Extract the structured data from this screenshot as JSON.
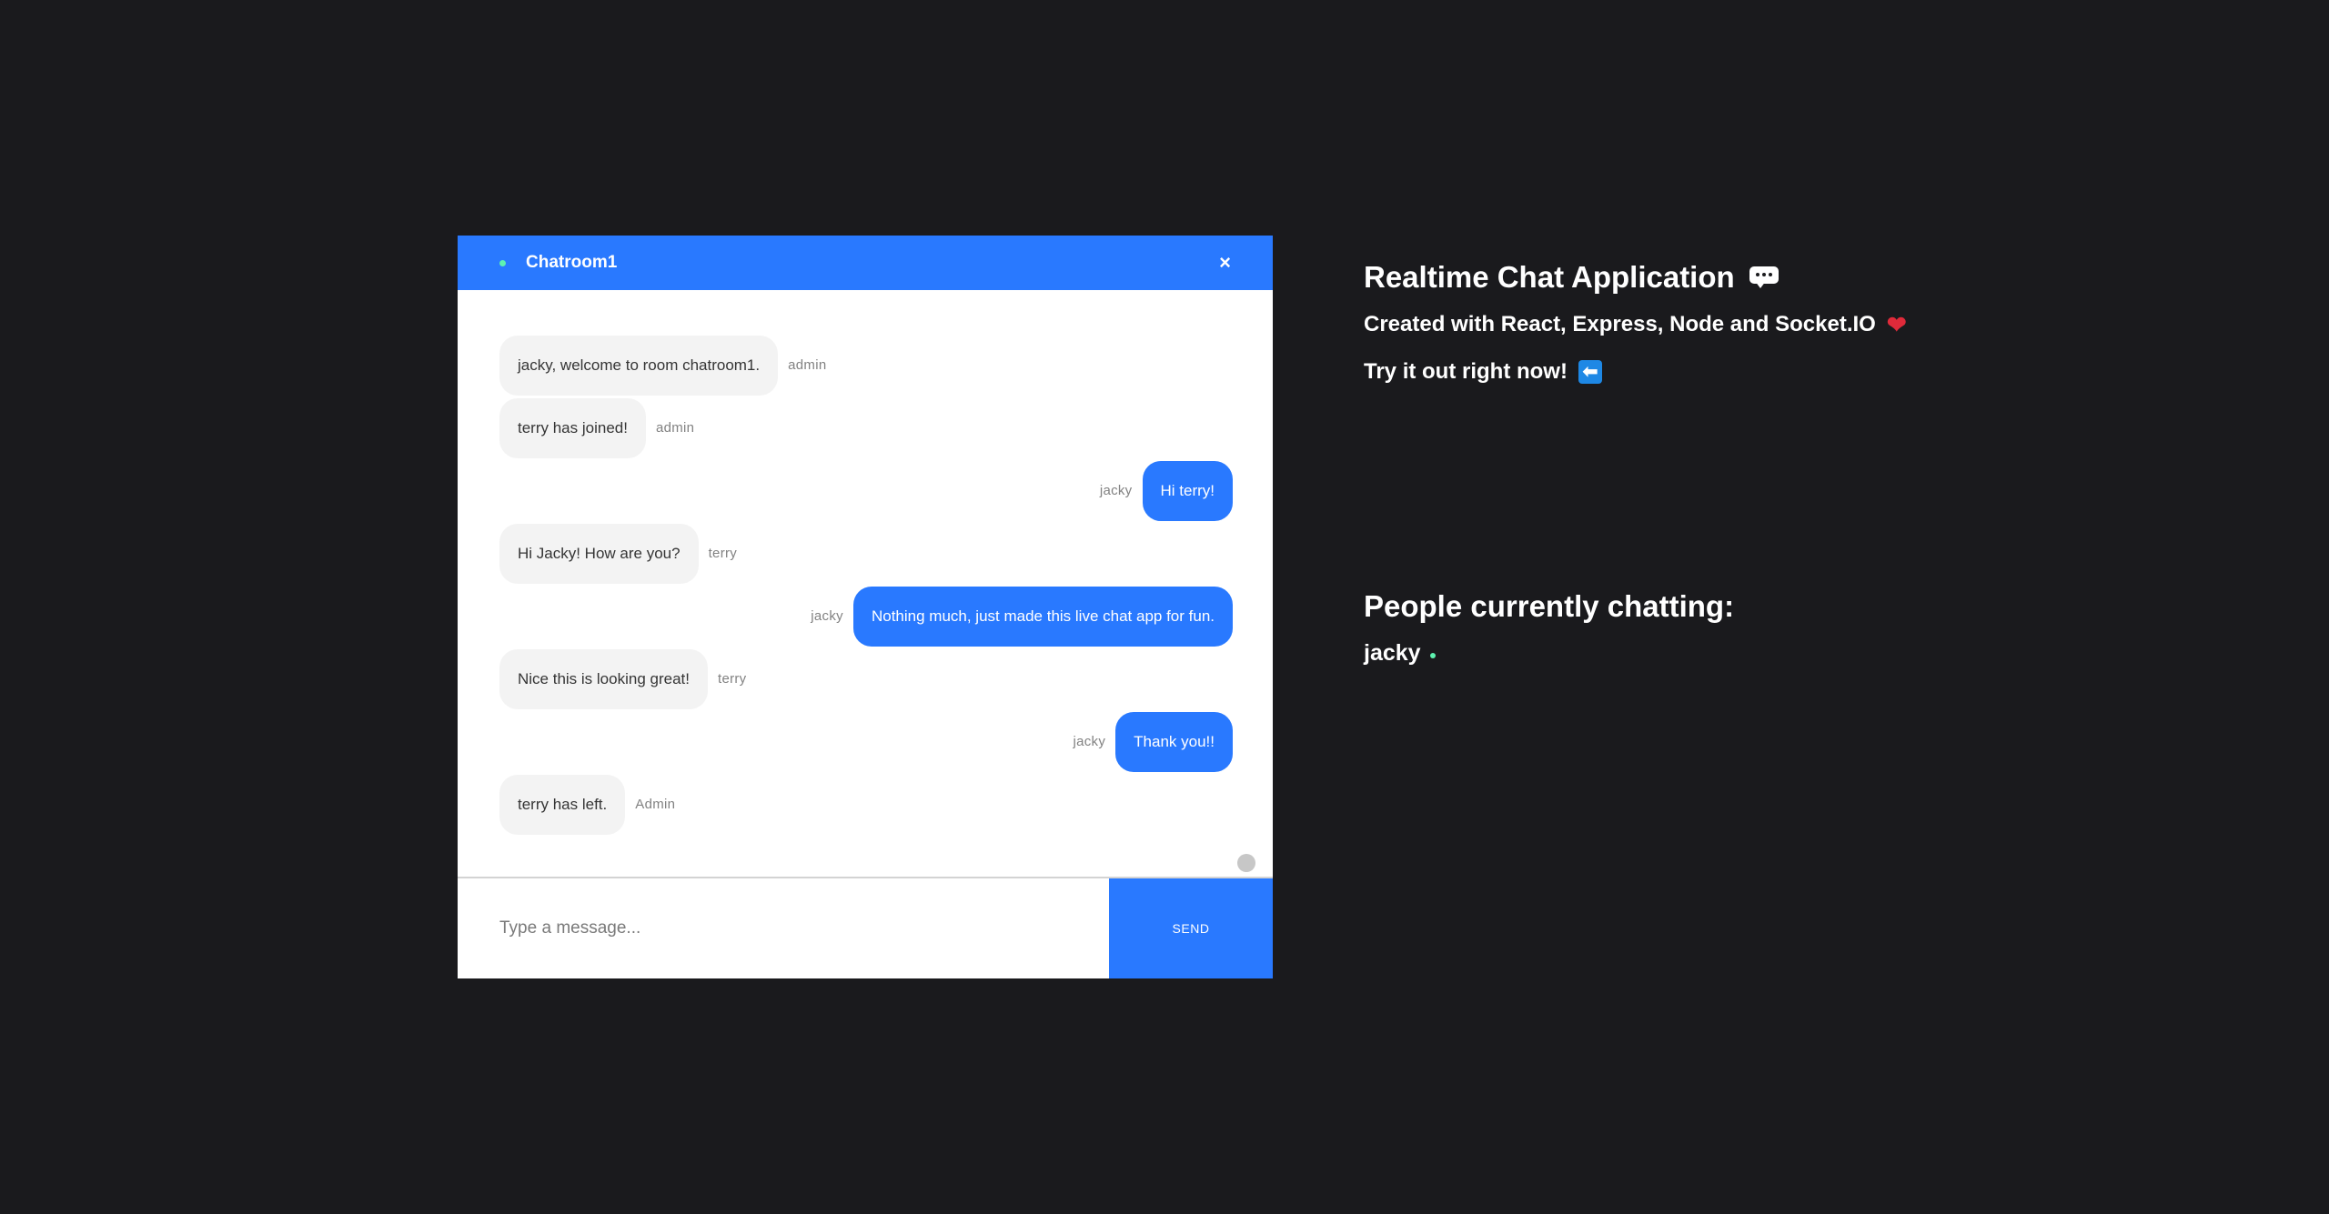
{
  "chat": {
    "room_name": "Chatroom1",
    "close_label": "×",
    "messages": [
      {
        "direction": "in",
        "text": "jacky, welcome to room chatroom1.",
        "sender": "admin"
      },
      {
        "direction": "in",
        "text": "terry has joined!",
        "sender": "admin"
      },
      {
        "direction": "out",
        "text": "Hi terry!",
        "sender": "jacky"
      },
      {
        "direction": "in",
        "text": "Hi Jacky! How are you?",
        "sender": "terry"
      },
      {
        "direction": "out",
        "text": "Nothing much, just made this live chat app for fun.",
        "sender": "jacky"
      },
      {
        "direction": "in",
        "text": "Nice this is looking great!",
        "sender": "terry"
      },
      {
        "direction": "out",
        "text": "Thank you!!",
        "sender": "jacky"
      },
      {
        "direction": "in",
        "text": "terry has left.",
        "sender": "Admin"
      }
    ],
    "input": {
      "placeholder": "Type a message...",
      "value": ""
    },
    "send_label": "SEND"
  },
  "info": {
    "title": "Realtime Chat Application",
    "created_with": "Created with React, Express, Node and Socket.IO",
    "try_it": "Try it out right now!",
    "title_icon": "speech-balloon-icon",
    "created_icon": "heart-icon",
    "try_icon": "left-arrow-icon"
  },
  "people": {
    "title": "People currently chatting:",
    "users": [
      "jacky"
    ]
  },
  "colors": {
    "accent": "#2979ff",
    "background": "#1a1a1d",
    "online": "#5ef2b0",
    "incoming_bubble": "#f3f3f3"
  }
}
